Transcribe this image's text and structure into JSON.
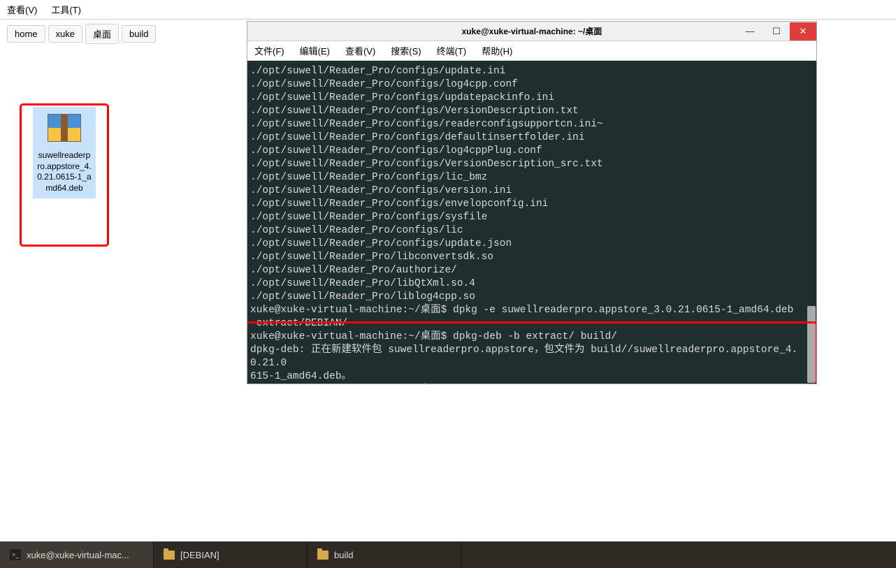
{
  "file_manager": {
    "menu": {
      "view": "查看(V)",
      "tools": "工具(T)"
    },
    "breadcrumb": [
      "home",
      "xuke",
      "桌面",
      "build"
    ],
    "selected_file": "suwellreaderpro.appstore_4.0.21.0615-1_amd64.deb"
  },
  "terminal": {
    "title": "xuke@xuke-virtual-machine: ~/桌面",
    "menu": {
      "file": "文件(F)",
      "edit": "编辑(E)",
      "view": "查看(V)",
      "search": "搜索(S)",
      "terminal": "终端(T)",
      "help": "帮助(H)"
    },
    "lines": [
      "./opt/suwell/Reader_Pro/configs/update.ini",
      "./opt/suwell/Reader_Pro/configs/log4cpp.conf",
      "./opt/suwell/Reader_Pro/configs/updatepackinfo.ini",
      "./opt/suwell/Reader_Pro/configs/VersionDescription.txt",
      "./opt/suwell/Reader_Pro/configs/readerconfigsupportcn.ini~",
      "./opt/suwell/Reader_Pro/configs/defaultinsertfolder.ini",
      "./opt/suwell/Reader_Pro/configs/log4cppPlug.conf",
      "./opt/suwell/Reader_Pro/configs/VersionDescription_src.txt",
      "./opt/suwell/Reader_Pro/configs/lic_bmz",
      "./opt/suwell/Reader_Pro/configs/version.ini",
      "./opt/suwell/Reader_Pro/configs/envelopconfig.ini",
      "./opt/suwell/Reader_Pro/configs/sysfile",
      "./opt/suwell/Reader_Pro/configs/lic",
      "./opt/suwell/Reader_Pro/configs/update.json",
      "./opt/suwell/Reader_Pro/libconvertsdk.so",
      "./opt/suwell/Reader_Pro/authorize/",
      "./opt/suwell/Reader_Pro/libQtXml.so.4",
      "./opt/suwell/Reader_Pro/liblog4cpp.so",
      "xuke@xuke-virtual-machine:~/桌面$ dpkg -e suwellreaderpro.appstore_3.0.21.0615-1_amd64.deb extract/DEBIAN/",
      "xuke@xuke-virtual-machine:~/桌面$ dpkg-deb -b extract/ build/",
      "dpkg-deb: 正在新建软件包 suwellreaderpro.appstore，包文件为 build//suwellreaderpro.appstore_4.0.21.0615-1_amd64.deb。",
      "xuke@xuke-virtual-machine:~/桌面$ "
    ]
  },
  "taskbar": {
    "items": [
      {
        "label": "xuke@xuke-virtual-mac...",
        "type": "terminal"
      },
      {
        "label": "[DEBIAN]",
        "type": "folder"
      },
      {
        "label": "build",
        "type": "folder"
      }
    ]
  }
}
